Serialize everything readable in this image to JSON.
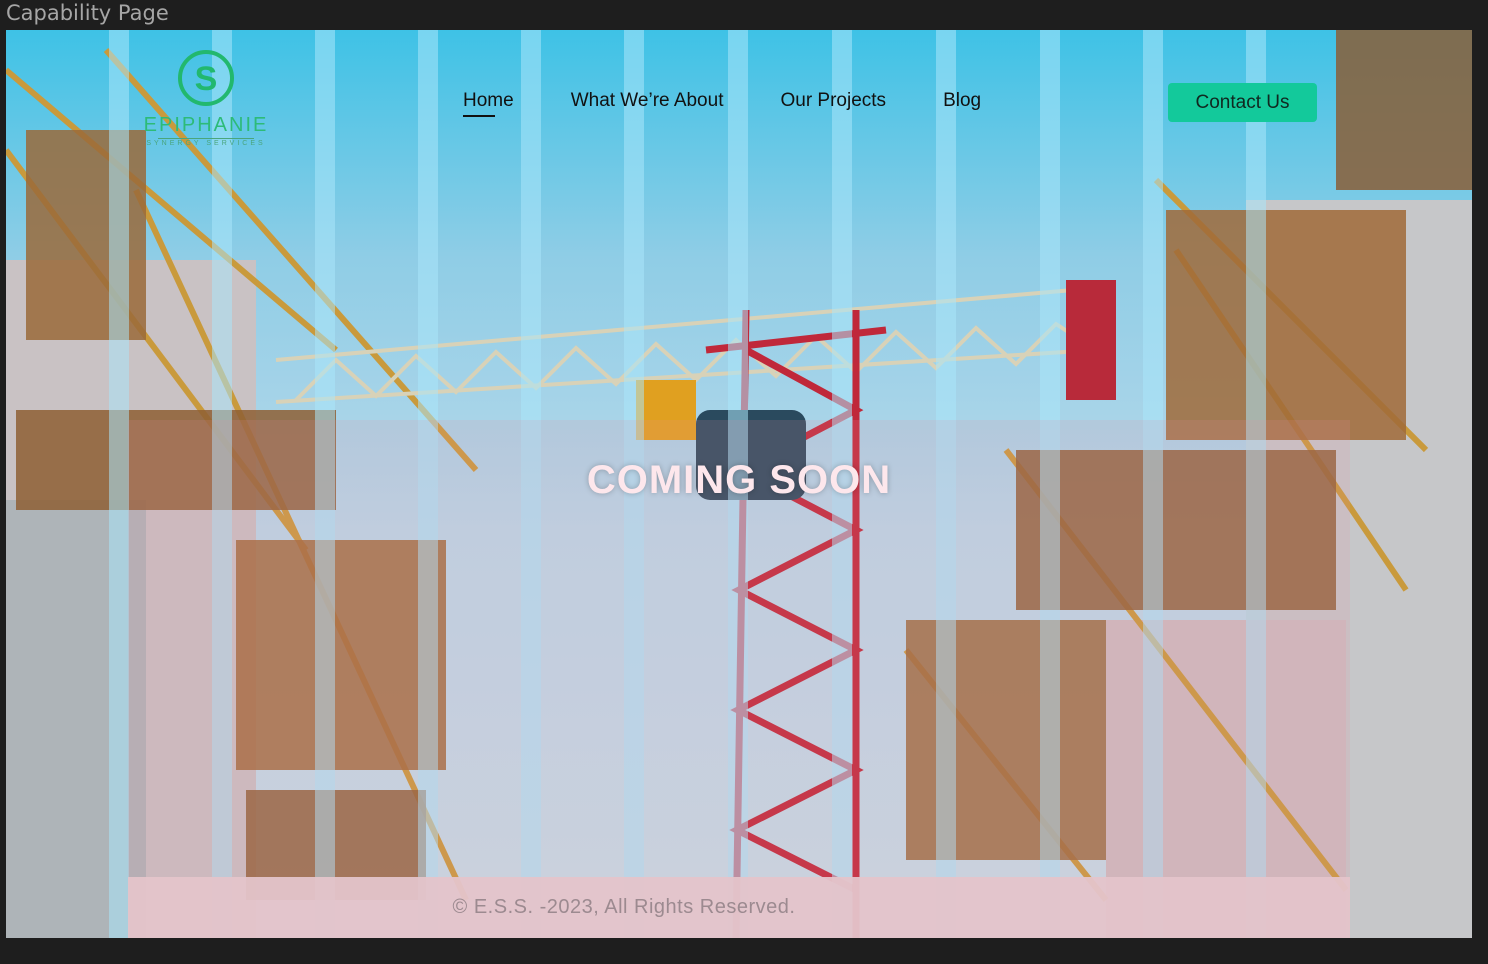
{
  "window": {
    "frame_label": "Capability Page"
  },
  "logo": {
    "name": "EPIPHANIE",
    "tagline": "SYNERGY SERVICES",
    "mark": "S"
  },
  "nav": {
    "items": [
      {
        "label": "Home",
        "active": true
      },
      {
        "label": "What We’re About",
        "active": false
      },
      {
        "label": "Our Projects",
        "active": false
      },
      {
        "label": "Blog",
        "active": false
      }
    ]
  },
  "cta": {
    "label": "Contact Us"
  },
  "hero": {
    "title": "COMING SOON"
  },
  "footer": {
    "text": "© E.S.S. -2023, All Rights Reserved."
  },
  "colors": {
    "accent": "#13c99b",
    "brand_green": "#2dbb78",
    "crane_red": "#c0283a",
    "scaffold_yellow": "#c9a43a"
  }
}
